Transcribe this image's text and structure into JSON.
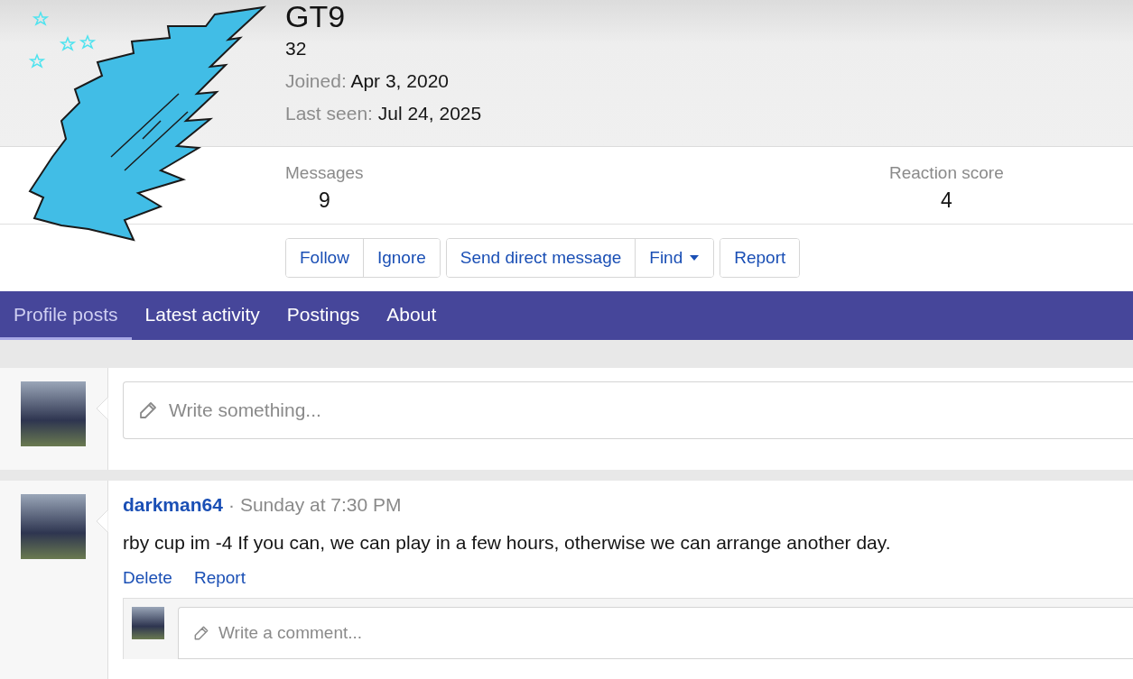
{
  "profile": {
    "name": "GT9",
    "title": "32",
    "joined_label": "Joined:",
    "joined": "Apr 3, 2020",
    "last_seen_label": "Last seen:",
    "last_seen": "Jul 24, 2025"
  },
  "stats": [
    {
      "label": "Messages",
      "value": "9"
    },
    {
      "label": "Reaction score",
      "value": "4"
    }
  ],
  "actions": [
    [
      {
        "label": "Follow",
        "kind": "plain"
      },
      {
        "label": "Ignore",
        "kind": "plain"
      }
    ],
    [
      {
        "label": "Send direct message",
        "kind": "plain"
      },
      {
        "label": "Find",
        "kind": "dropdown"
      }
    ],
    [
      {
        "label": "Report",
        "kind": "plain"
      }
    ]
  ],
  "tabs": [
    {
      "label": "Profile posts",
      "selected": true
    },
    {
      "label": "Latest activity",
      "selected": false
    },
    {
      "label": "Postings",
      "selected": false
    },
    {
      "label": "About",
      "selected": false
    }
  ],
  "composer": {
    "placeholder": "Write something..."
  },
  "posts": [
    {
      "author": "darkman64",
      "separator": "·",
      "time": "Sunday at 7:30 PM",
      "text": "rby cup im -4 If you can, we can play in a few hours, otherwise we can arrange another day.",
      "links": [
        "Delete",
        "Report"
      ],
      "comment_placeholder": "Write a comment..."
    }
  ]
}
